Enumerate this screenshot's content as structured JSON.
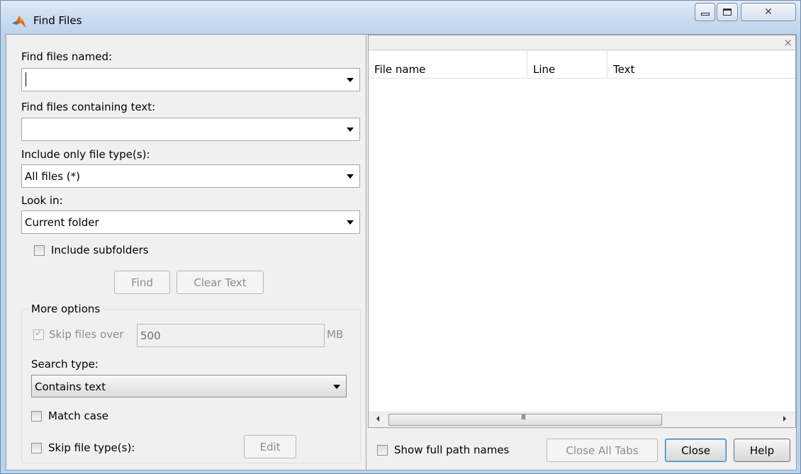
{
  "window": {
    "title": "Find Files",
    "controls": {
      "minimize": "minimize",
      "maximize": "maximize",
      "close": "close"
    }
  },
  "left_panel": {
    "name_label": "Find files named:",
    "name_value": "",
    "text_label": "Find files containing text:",
    "text_value": "",
    "type_label": "Include only file type(s):",
    "type_value": "All files (*)",
    "lookin_label": "Look in:",
    "lookin_value": "Current folder",
    "include_subfolders": {
      "label": "Include subfolders",
      "checked": false
    },
    "find_button": "Find",
    "clear_button": "Clear Text",
    "more_options": {
      "title": "More options",
      "skip_files_over": {
        "label": "Skip files over",
        "checked": true,
        "value": "500",
        "unit": "MB"
      },
      "search_type_label": "Search type:",
      "search_type_value": "Contains text",
      "match_case": {
        "label": "Match case",
        "checked": false
      },
      "skip_file_types": {
        "label": "Skip file type(s):",
        "checked": false
      },
      "edit_button": "Edit"
    }
  },
  "results": {
    "close_symbol": "×",
    "columns": [
      "File name",
      "Line",
      "Text"
    ],
    "rows": [],
    "scroll_grip": "III"
  },
  "bottom_bar": {
    "show_full_path": {
      "label": "Show full path names",
      "checked": false
    },
    "close_all_tabs_button": "Close All Tabs",
    "close_button": "Close",
    "help_button": "Help"
  }
}
